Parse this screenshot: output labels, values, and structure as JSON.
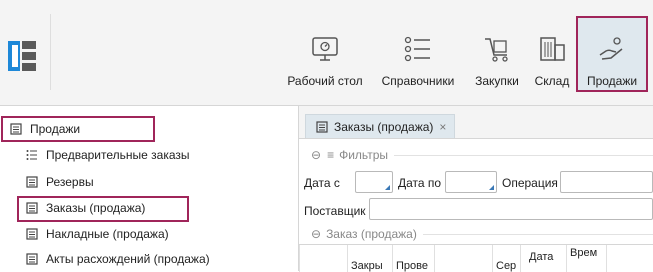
{
  "toolbar": {
    "buttons": [
      {
        "label": "Рабочий стол",
        "icon": "desktop-icon"
      },
      {
        "label": "Справочники",
        "icon": "list-icon"
      },
      {
        "label": "Закупки",
        "icon": "cart-icon"
      },
      {
        "label": "Склад",
        "icon": "warehouse-icon"
      },
      {
        "label": "Продажи",
        "icon": "sales-hand-icon"
      }
    ],
    "active": "Продажи",
    "accent": "#a0255a",
    "logo_color": "#1e88d8"
  },
  "nav": {
    "root": {
      "label": "Продажи",
      "icon": "document-icon"
    },
    "items": [
      {
        "label": "Предварительные заказы",
        "icon": "list-lines-icon"
      },
      {
        "label": "Резервы",
        "icon": "document-icon"
      },
      {
        "label": "Заказы (продажа)",
        "icon": "document-icon"
      },
      {
        "label": "Накладные (продажа)",
        "icon": "document-icon"
      },
      {
        "label": "Акты расхождений (продажа)",
        "icon": "document-icon"
      }
    ]
  },
  "content": {
    "tab": {
      "label": "Заказы (продажа)",
      "close": "×"
    },
    "filters": {
      "title": "Фильтры",
      "date_from": "Дата с",
      "date_to": "Дата по",
      "operation": "Операция",
      "supplier": "Поставщик"
    },
    "order_section": {
      "title": "Заказ (продажа)",
      "columns": [
        "Закры",
        "Прове",
        "Сер",
        "Дата",
        "Врем"
      ]
    }
  }
}
